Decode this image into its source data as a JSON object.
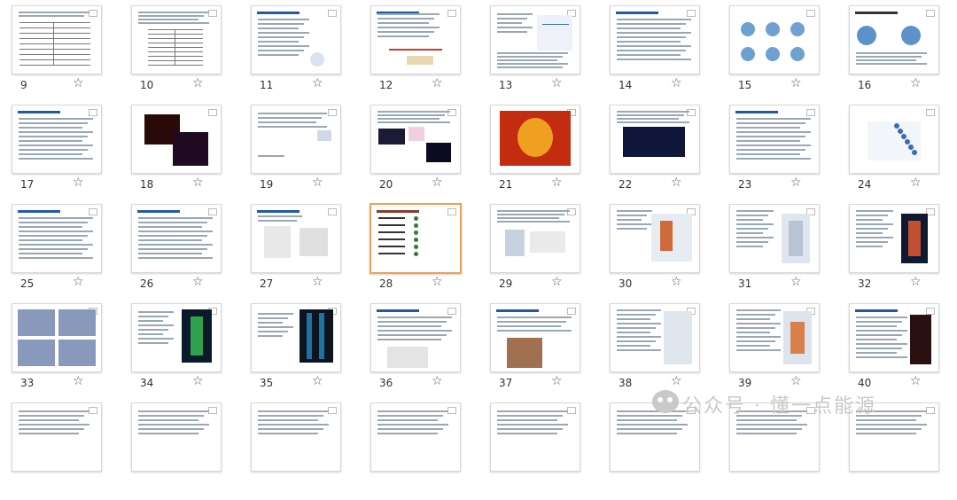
{
  "slides": [
    {
      "n": "9"
    },
    {
      "n": "10"
    },
    {
      "n": "11"
    },
    {
      "n": "12"
    },
    {
      "n": "13"
    },
    {
      "n": "14"
    },
    {
      "n": "15"
    },
    {
      "n": "16"
    },
    {
      "n": "17"
    },
    {
      "n": "18"
    },
    {
      "n": "19"
    },
    {
      "n": "20"
    },
    {
      "n": "21"
    },
    {
      "n": "22"
    },
    {
      "n": "23"
    },
    {
      "n": "24"
    },
    {
      "n": "25"
    },
    {
      "n": "26"
    },
    {
      "n": "27"
    },
    {
      "n": "28"
    },
    {
      "n": "29"
    },
    {
      "n": "30"
    },
    {
      "n": "31"
    },
    {
      "n": "32"
    },
    {
      "n": "33"
    },
    {
      "n": "34"
    },
    {
      "n": "35"
    },
    {
      "n": "36"
    },
    {
      "n": "37"
    },
    {
      "n": "38"
    },
    {
      "n": "39"
    },
    {
      "n": "40"
    },
    {
      "n": ""
    },
    {
      "n": ""
    },
    {
      "n": ""
    },
    {
      "n": ""
    },
    {
      "n": ""
    },
    {
      "n": ""
    },
    {
      "n": ""
    },
    {
      "n": ""
    }
  ],
  "selected_slide": "28",
  "star_icon": "☆",
  "watermark": "公众号 · 懂一点能源",
  "colors": {
    "selected_border": "#f0a050",
    "title_blue": "#1f5aa6",
    "background": "#ffffff"
  }
}
